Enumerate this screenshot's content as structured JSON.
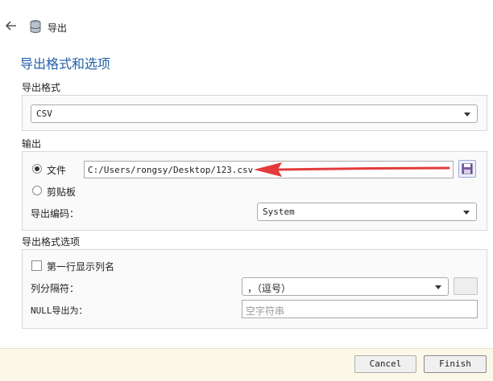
{
  "header": {
    "title": "导出",
    "back_icon": "back-arrow-icon",
    "app_icon": "database-icon"
  },
  "page_title": "导出格式和选项",
  "format_section": {
    "label": "导出格式",
    "selected": "CSV"
  },
  "output_section": {
    "label": "输出",
    "file_label": "文件",
    "file_path": "C:/Users/rongsy/Desktop/123.csv",
    "clipboard_label": "剪贴板",
    "encoding_label": "导出编码：",
    "encoding_value": "System"
  },
  "options_section": {
    "label": "导出格式选项",
    "first_row_label": "第一行显示列名",
    "separator_label": "列分隔符：",
    "separator_value": "，（逗号）",
    "null_label": "NULL导出为：",
    "null_placeholder": "空字符串"
  },
  "footer": {
    "cancel_label": "Cancel",
    "finish_label": "Finish"
  },
  "colors": {
    "title": "#1f5fa8",
    "annotation_arrow": "#e23b3b",
    "footer_bg": "#fbf8e8"
  }
}
